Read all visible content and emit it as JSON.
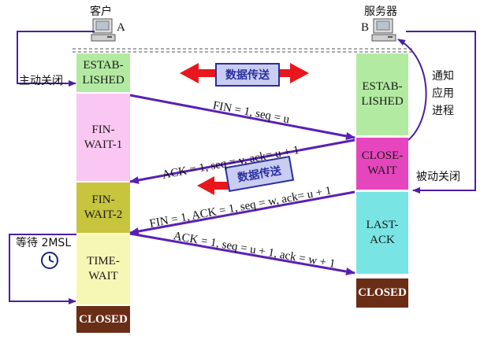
{
  "hosts": {
    "client": {
      "label": "客户",
      "letter": "A"
    },
    "server": {
      "label": "服务器",
      "letter": "B"
    }
  },
  "client_states": {
    "established": "ESTAB-\nLISHED",
    "fin_wait_1": "FIN-\nWAIT-1",
    "fin_wait_2": "FIN-\nWAIT-2",
    "time_wait": "TIME-\nWAIT",
    "closed": "CLOSED"
  },
  "server_states": {
    "established": "ESTAB-\nLISHED",
    "close_wait": "CLOSE-\nWAIT",
    "last_ack": "LAST-\nACK",
    "closed": "CLOSED"
  },
  "notes": {
    "active_close": "主动关闭",
    "passive_close": "被动关闭",
    "notify_app": "通知\n应用\n进程",
    "wait_2msl": "等待 2MSL"
  },
  "transfer_labels": {
    "top": "数据传送",
    "middle": "数据传送"
  },
  "messages": {
    "fin1": "FIN = 1, seq = u",
    "ack1": "ACK = 1, seq = v, ack= u + 1",
    "fin2": "FIN = 1, ACK = 1, seq = w, ack= u + 1",
    "ack2": "ACK = 1, seq = u + 1, ack = w + 1"
  },
  "icons": [
    "computer-icon",
    "clock-icon"
  ],
  "colors": {
    "established": "#b3eaa2",
    "fin_wait_1": "#f9c7f1",
    "fin_wait_2": "#c7c43d",
    "time_wait": "#f7f7b5",
    "close_wait": "#e646bd",
    "last_ack": "#79e4e4",
    "closed": "#6a2d16",
    "arrow": "#5a20b4",
    "transfer_arrow": "#e8171d",
    "loop_line": "#4b1fa2"
  }
}
